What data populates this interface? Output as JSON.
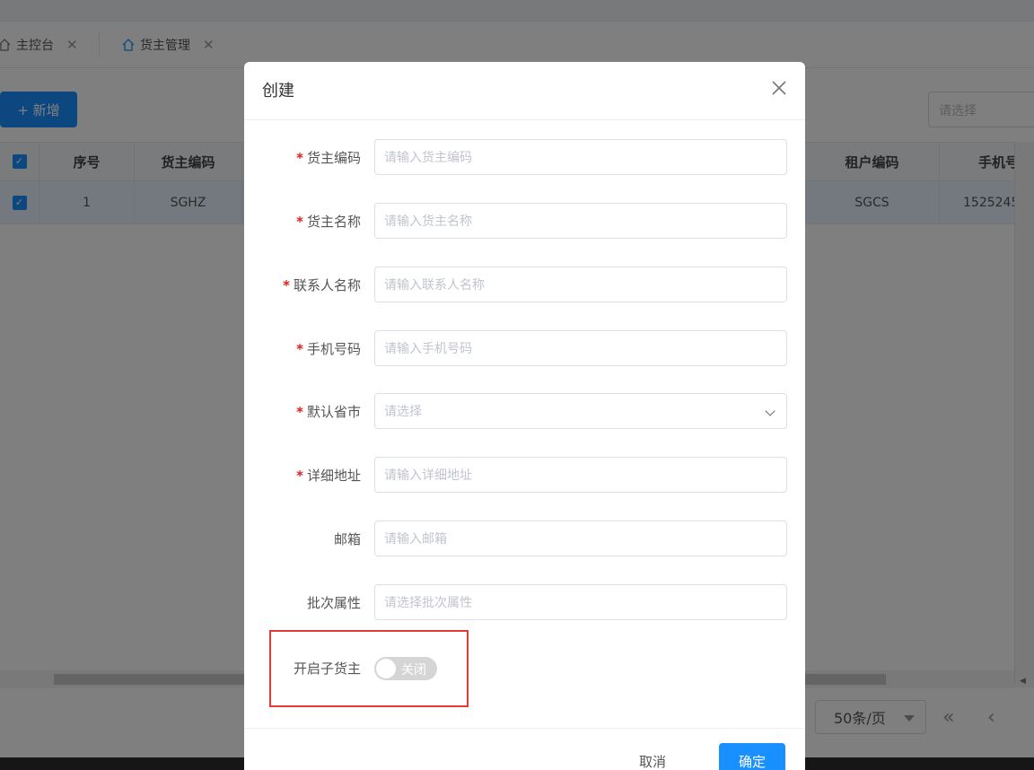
{
  "tabs": [
    {
      "label": "主控台",
      "close": "✕"
    },
    {
      "label": "货主管理",
      "close": "✕"
    }
  ],
  "toolbar": {
    "add_label": "+ 新增",
    "filter_placeholder": "请选择"
  },
  "table": {
    "headers": {
      "index": "序号",
      "owner_code": "货主编码",
      "tenant_code": "租户编码",
      "phone": "手机号"
    },
    "rows": [
      {
        "index": "1",
        "owner_code": "SGHZ",
        "tenant_code": "SGCS",
        "phone": "1525245"
      }
    ]
  },
  "pager": {
    "page_size": "50条/页",
    "first": "«",
    "prev": "‹"
  },
  "modal": {
    "title": "创建",
    "fields": [
      {
        "label": "货主编码",
        "required": true,
        "placeholder": "请输入货主编码"
      },
      {
        "label": "货主名称",
        "required": true,
        "placeholder": "请输入货主名称"
      },
      {
        "label": "联系人名称",
        "required": true,
        "placeholder": "请输入联系人名称"
      },
      {
        "label": "手机号码",
        "required": true,
        "placeholder": "请输入手机号码"
      },
      {
        "label": "默认省市",
        "required": true,
        "placeholder": "请选择"
      },
      {
        "label": "详细地址",
        "required": true,
        "placeholder": "请输入详细地址"
      },
      {
        "label": "邮箱",
        "required": false,
        "placeholder": "请输入邮箱"
      },
      {
        "label": "批次属性",
        "required": false,
        "placeholder": "请选择批次属性"
      }
    ],
    "sub_owner": {
      "label": "开启子货主",
      "switch_text": "关闭",
      "enabled": false
    },
    "required_mark": "*",
    "cancel_label": "取消",
    "ok_label": "确定"
  },
  "colors": {
    "primary": "#1890ff",
    "required": "#e02020",
    "highlight": "#e53935"
  }
}
